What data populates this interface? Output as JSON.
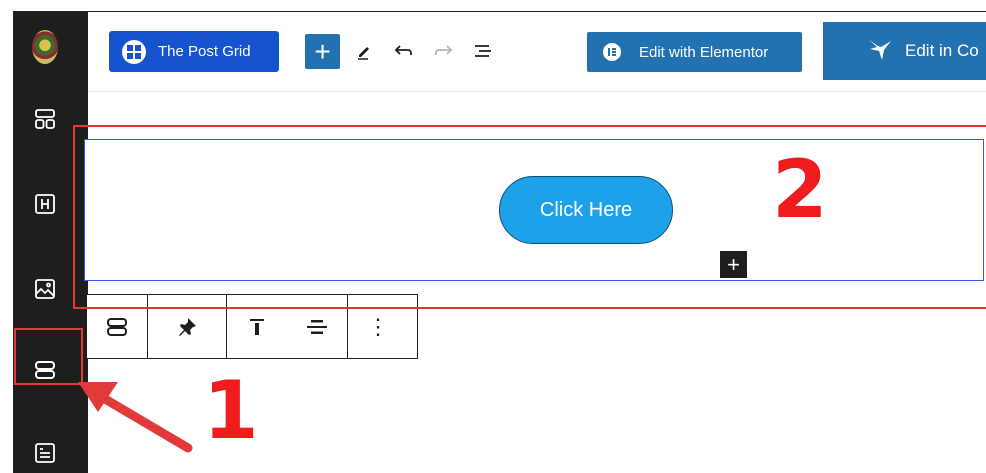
{
  "toolbar": {
    "post_grid_label": "The Post Grid",
    "add_block_symbol": "+",
    "edit_elementor_label": "Edit with Elementor",
    "edit_in_label": "Edit in Co"
  },
  "sidebar": {
    "items": [
      {
        "name": "site-logo",
        "icon": "logo-icon"
      },
      {
        "name": "layout-icon",
        "icon": "grid-layout-icon"
      },
      {
        "name": "heading-icon",
        "icon": "heading-block-icon"
      },
      {
        "name": "image-icon",
        "icon": "image-block-icon"
      },
      {
        "name": "buttons-icon",
        "icon": "buttons-block-icon"
      },
      {
        "name": "text-icon",
        "icon": "text-block-icon"
      }
    ]
  },
  "block": {
    "button_text": "Click Here",
    "inserter_symbol": "+"
  },
  "block_toolbar": {
    "more_symbol": "⋮"
  },
  "annotations": {
    "label_1": "1",
    "label_2": "2",
    "color": "#e23a3a"
  },
  "colors": {
    "post_grid_blue": "#1653cf",
    "wp_blue": "#2271b1",
    "button_cyan": "#1da1e8",
    "sidebar_dark": "#1e1e1e",
    "selection_blue": "#3858e9"
  }
}
